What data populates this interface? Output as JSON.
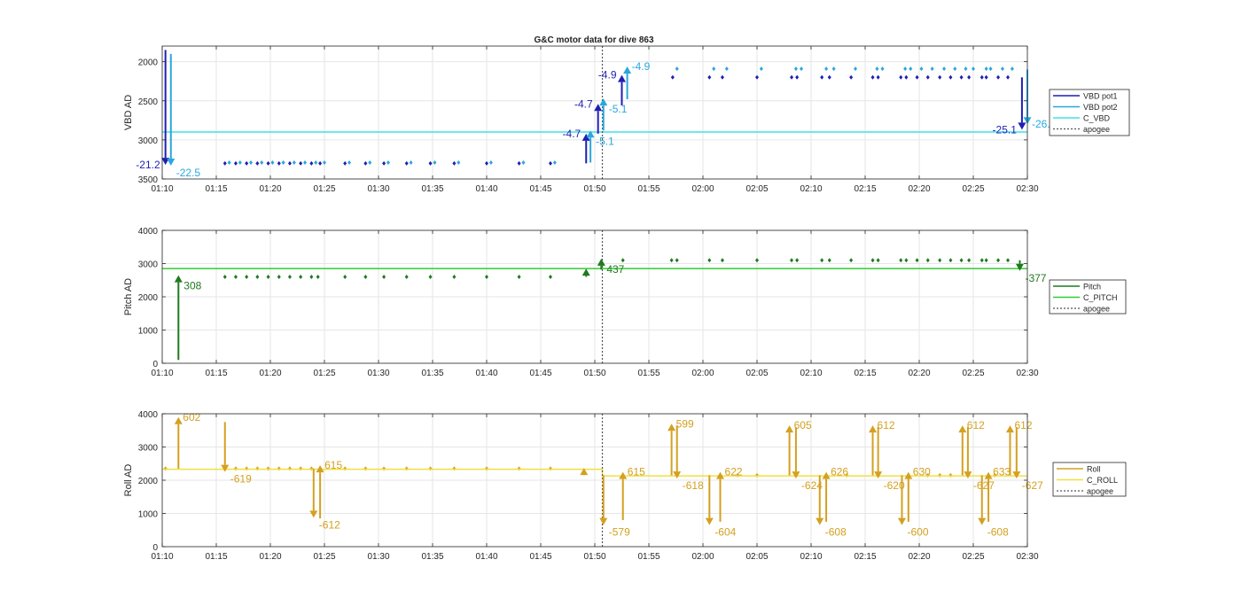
{
  "figure": {
    "title": "G&C motor data for dive 863"
  },
  "chart_data": [
    {
      "type": "scatter",
      "title": "G&C motor data for dive 863",
      "ylabel": "VBD AD",
      "ylim": [
        3500,
        1800
      ],
      "y_reversed": true,
      "yticks": [
        2000,
        2500,
        3000,
        3500
      ],
      "xlim": [
        "01:10",
        "02:30"
      ],
      "xticks": [
        "01:10",
        "01:15",
        "01:20",
        "01:25",
        "01:30",
        "01:35",
        "01:40",
        "01:45",
        "01:50",
        "01:55",
        "02:00",
        "02:05",
        "02:10",
        "02:15",
        "02:20",
        "02:25",
        "02:30"
      ],
      "grid": true,
      "legend_position": "outside-right",
      "apogee": "01:50.7",
      "colors": {
        "VBD pot1": "#1f1fb4",
        "VBD pot2": "#2aa7dd",
        "C_VBD": "#40e0e8",
        "apogee": "#555555"
      },
      "series": [
        {
          "name": "VBD pot1",
          "style": "points",
          "x": [
            "01:15.8",
            "01:16.8",
            "01:17.8",
            "01:18.8",
            "01:19.8",
            "01:20.8",
            "01:21.8",
            "01:22.8",
            "01:23.8",
            "01:24.6",
            "01:26.9",
            "01:28.8",
            "01:30.5",
            "01:32.6",
            "01:34.8",
            "01:37.0",
            "01:40.0",
            "01:43.0",
            "01:45.9",
            "01:57.2",
            "02:00.6",
            "02:01.8",
            "02:05.0",
            "02:08.2",
            "02:08.7",
            "02:11.0",
            "02:11.7",
            "02:13.7",
            "02:15.7",
            "02:16.2",
            "02:18.3",
            "02:18.8",
            "02:19.8",
            "02:20.8",
            "02:21.9",
            "02:22.9",
            "02:23.9",
            "02:24.6",
            "02:25.8",
            "02:26.2",
            "02:27.3",
            "02:28.2"
          ],
          "y": [
            3300,
            3300,
            3300,
            3300,
            3300,
            3300,
            3300,
            3300,
            3300,
            3300,
            3300,
            3300,
            3300,
            3300,
            3300,
            3300,
            3300,
            3300,
            3300,
            2200,
            2200,
            2200,
            2200,
            2200,
            2200,
            2200,
            2200,
            2200,
            2200,
            2200,
            2200,
            2200,
            2200,
            2200,
            2200,
            2200,
            2200,
            2200,
            2200,
            2200,
            2200,
            2200
          ]
        },
        {
          "name": "VBD pot2",
          "style": "points",
          "x": [
            "01:16.2",
            "01:17.2",
            "01:18.2",
            "01:19.2",
            "01:20.2",
            "01:21.2",
            "01:22.2",
            "01:23.2",
            "01:24.2",
            "01:25.0",
            "01:27.3",
            "01:29.2",
            "01:30.9",
            "01:33.0",
            "01:35.2",
            "01:37.4",
            "01:40.4",
            "01:43.4",
            "01:46.3",
            "01:57.6",
            "02:01.0",
            "02:02.2",
            "02:05.4",
            "02:08.6",
            "02:09.1",
            "02:11.4",
            "02:12.1",
            "02:14.1",
            "02:16.1",
            "02:16.6",
            "02:18.7",
            "02:19.2",
            "02:20.2",
            "02:21.2",
            "02:22.3",
            "02:23.3",
            "02:24.3",
            "02:25.0",
            "02:26.2",
            "02:26.6",
            "02:27.7",
            "02:28.6"
          ],
          "y": [
            3290,
            3290,
            3290,
            3290,
            3290,
            3290,
            3290,
            3290,
            3290,
            3290,
            3290,
            3290,
            3290,
            3290,
            3290,
            3290,
            3290,
            3290,
            3290,
            2090,
            2090,
            2090,
            2090,
            2090,
            2090,
            2090,
            2090,
            2090,
            2090,
            2090,
            2090,
            2090,
            2090,
            2090,
            2090,
            2090,
            2090,
            2090,
            2090,
            2090,
            2090,
            2090
          ]
        },
        {
          "name": "C_VBD",
          "style": "line",
          "x": [
            "01:10",
            "02:30"
          ],
          "y": [
            2900,
            2900
          ]
        },
        {
          "name": "apogee",
          "style": "dotted-vline",
          "x": [
            "01:50.7"
          ]
        }
      ],
      "arrows": [
        {
          "series": "VBD pot1",
          "x": "01:10.3",
          "y_start": 1850,
          "y_end": 3320,
          "label": "-21.2",
          "label_side": "left"
        },
        {
          "series": "VBD pot2",
          "x": "01:10.8",
          "y_start": 1900,
          "y_end": 3330,
          "label": "-22.5",
          "label_side": "right-below"
        },
        {
          "series": "VBD pot1",
          "x": "01:49.2",
          "y_start": 3300,
          "y_end": 2920,
          "label": "-4.7",
          "label_side": "left"
        },
        {
          "series": "VBD pot2",
          "x": "01:49.6",
          "y_start": 3290,
          "y_end": 2880,
          "label": "-5.1",
          "label_side": "right-below"
        },
        {
          "series": "VBD pot1",
          "x": "01:50.3",
          "y_start": 2920,
          "y_end": 2540,
          "label": "-4.7",
          "label_side": "left"
        },
        {
          "series": "VBD pot2",
          "x": "01:50.8",
          "y_start": 2880,
          "y_end": 2470,
          "label": "-5.1",
          "label_side": "right-below"
        },
        {
          "series": "VBD pot1",
          "x": "01:52.5",
          "y_start": 2560,
          "y_end": 2170,
          "label": "-4.9",
          "label_side": "left"
        },
        {
          "series": "VBD pot2",
          "x": "01:53.0",
          "y_start": 2480,
          "y_end": 2060,
          "label": "-4.9",
          "label_side": "right"
        },
        {
          "series": "VBD pot1",
          "x": "02:29.5",
          "y_start": 2200,
          "y_end": 2870,
          "label": "-25.1",
          "label_side": "left"
        },
        {
          "series": "VBD pot2",
          "x": "02:30.0",
          "y_start": 2100,
          "y_end": 2800,
          "label": "-26.",
          "label_side": "right"
        }
      ]
    },
    {
      "type": "scatter",
      "ylabel": "Pitch AD",
      "ylim": [
        0,
        4000
      ],
      "yticks": [
        0,
        1000,
        2000,
        3000,
        4000
      ],
      "xlim": [
        "01:10",
        "02:30"
      ],
      "xticks": [
        "01:10",
        "01:15",
        "01:20",
        "01:25",
        "01:30",
        "01:35",
        "01:40",
        "01:45",
        "01:50",
        "01:55",
        "02:00",
        "02:05",
        "02:10",
        "02:15",
        "02:20",
        "02:25",
        "02:30"
      ],
      "grid": true,
      "legend_position": "outside-right",
      "apogee": "01:50.7",
      "colors": {
        "Pitch": "#1f7a1f",
        "C_PITCH": "#33cc33",
        "apogee": "#555555"
      },
      "series": [
        {
          "name": "Pitch",
          "style": "points",
          "x": [
            "01:15.8",
            "01:16.8",
            "01:17.8",
            "01:18.8",
            "01:19.8",
            "01:20.8",
            "01:21.8",
            "01:22.8",
            "01:23.8",
            "01:24.4",
            "01:26.9",
            "01:28.8",
            "01:30.5",
            "01:32.6",
            "01:34.8",
            "01:37.0",
            "01:40.0",
            "01:43.0",
            "01:45.9",
            "01:52.6",
            "01:57.1",
            "01:57.6",
            "02:00.6",
            "02:01.8",
            "02:05.0",
            "02:08.2",
            "02:08.7",
            "02:11.0",
            "02:11.7",
            "02:13.7",
            "02:15.7",
            "02:16.2",
            "02:18.3",
            "02:18.8",
            "02:19.8",
            "02:20.8",
            "02:21.9",
            "02:22.9",
            "02:23.9",
            "02:24.6",
            "02:25.8",
            "02:26.2",
            "02:27.3",
            "02:28.2"
          ],
          "y": [
            2600,
            2600,
            2600,
            2600,
            2600,
            2600,
            2600,
            2600,
            2600,
            2600,
            2600,
            2600,
            2600,
            2600,
            2600,
            2600,
            2600,
            2600,
            2600,
            3100,
            3100,
            3100,
            3100,
            3100,
            3100,
            3100,
            3100,
            3100,
            3100,
            3100,
            3100,
            3100,
            3100,
            3100,
            3100,
            3100,
            3100,
            3100,
            3100,
            3100,
            3100,
            3100,
            3100,
            3100
          ]
        },
        {
          "name": "C_PITCH",
          "style": "line",
          "x": [
            "01:10",
            "02:30"
          ],
          "y": [
            2850,
            2850
          ]
        },
        {
          "name": "apogee",
          "style": "dotted-vline",
          "x": [
            "01:50.7"
          ]
        }
      ],
      "arrows": [
        {
          "series": "Pitch",
          "x": "01:11.5",
          "y_start": 100,
          "y_end": 2650,
          "label": "308",
          "label_side": "right-below"
        },
        {
          "series": "Pitch",
          "x": "01:49.2",
          "y_start": 2600,
          "y_end": 2850,
          "label": "",
          "label_side": "none"
        },
        {
          "series": "Pitch",
          "x": "01:50.6",
          "y_start": 2820,
          "y_end": 3150,
          "label": "437",
          "label_side": "right-below"
        },
        {
          "series": "Pitch",
          "x": "02:29.3",
          "y_start": 3100,
          "y_end": 2780,
          "label": "-377",
          "label_side": "right-below"
        }
      ]
    },
    {
      "type": "scatter",
      "ylabel": "Roll AD",
      "ylim": [
        0,
        4000
      ],
      "yticks": [
        0,
        1000,
        2000,
        3000,
        4000
      ],
      "xlim": [
        "01:10",
        "02:30"
      ],
      "xticks": [
        "01:10",
        "01:15",
        "01:20",
        "01:25",
        "01:30",
        "01:35",
        "01:40",
        "01:45",
        "01:50",
        "01:55",
        "02:00",
        "02:05",
        "02:10",
        "02:15",
        "02:20",
        "02:25",
        "02:30"
      ],
      "grid": true,
      "legend_position": "outside-right",
      "apogee": "01:50.7",
      "colors": {
        "Roll": "#d4a020",
        "C_ROLL": "#f0e040",
        "apogee": "#555555"
      },
      "series": [
        {
          "name": "Roll",
          "style": "points",
          "x": [
            "01:10.3",
            "01:16.8",
            "01:17.8",
            "01:18.8",
            "01:19.8",
            "01:20.8",
            "01:21.8",
            "01:22.8",
            "01:23.8",
            "01:26.9",
            "01:28.8",
            "01:30.5",
            "01:32.6",
            "01:34.8",
            "01:37.0",
            "01:40.0",
            "01:43.0",
            "01:45.9",
            "02:03.2",
            "02:05.0",
            "02:13.3",
            "02:20.8",
            "02:21.9",
            "02:22.9",
            "02:27.0"
          ],
          "y": [
            2350,
            2350,
            2350,
            2350,
            2350,
            2350,
            2350,
            2350,
            2350,
            2350,
            2350,
            2350,
            2350,
            2350,
            2350,
            2350,
            2350,
            2350,
            2150,
            2150,
            2150,
            2150,
            2150,
            2150,
            2150
          ]
        },
        {
          "name": "C_ROLL",
          "style": "line",
          "x": [
            "01:10",
            "01:50.7",
            "01:50.7",
            "02:30"
          ],
          "y": [
            2330,
            2330,
            2130,
            2130
          ]
        },
        {
          "name": "apogee",
          "style": "dotted-vline",
          "x": [
            "01:50.7"
          ]
        }
      ],
      "arrows": [
        {
          "series": "Roll",
          "x": "01:11.5",
          "y_start": 2350,
          "y_end": 3900,
          "label": "602",
          "label_side": "right"
        },
        {
          "series": "Roll",
          "x": "01:15.8",
          "y_start": 3750,
          "y_end": 2250,
          "label": "-619",
          "label_side": "right-below"
        },
        {
          "series": "Roll",
          "x": "01:24.0",
          "y_start": 2350,
          "y_end": 870,
          "label": "-612",
          "label_side": "right-below"
        },
        {
          "series": "Roll",
          "x": "01:24.6",
          "y_start": 850,
          "y_end": 2450,
          "label": "615",
          "label_side": "right"
        },
        {
          "series": "Roll",
          "x": "01:49.0",
          "y_start": 2150,
          "y_end": 2370,
          "label": "",
          "label_side": "none"
        },
        {
          "series": "Roll",
          "x": "01:50.8",
          "y_start": 2150,
          "y_end": 650,
          "label": "-579",
          "label_side": "right-below"
        },
        {
          "series": "Roll",
          "x": "01:52.6",
          "y_start": 800,
          "y_end": 2250,
          "label": "615",
          "label_side": "right"
        },
        {
          "series": "Roll",
          "x": "01:57.1",
          "y_start": 2150,
          "y_end": 3700,
          "label": "599",
          "label_side": "right"
        },
        {
          "series": "Roll",
          "x": "01:57.6",
          "y_start": 3650,
          "y_end": 2050,
          "label": "-618",
          "label_side": "right-below"
        },
        {
          "series": "Roll",
          "x": "02:00.6",
          "y_start": 2150,
          "y_end": 650,
          "label": "-604",
          "label_side": "right-below"
        },
        {
          "series": "Roll",
          "x": "02:01.6",
          "y_start": 750,
          "y_end": 2250,
          "label": "622",
          "label_side": "right"
        },
        {
          "series": "Roll",
          "x": "02:08.0",
          "y_start": 2150,
          "y_end": 3650,
          "label": "605",
          "label_side": "right"
        },
        {
          "series": "Roll",
          "x": "02:08.6",
          "y_start": 3600,
          "y_end": 2050,
          "label": "-624",
          "label_side": "right-below"
        },
        {
          "series": "Roll",
          "x": "02:10.8",
          "y_start": 2150,
          "y_end": 650,
          "label": "-608",
          "label_side": "right-below"
        },
        {
          "series": "Roll",
          "x": "02:11.4",
          "y_start": 750,
          "y_end": 2250,
          "label": "626",
          "label_side": "right"
        },
        {
          "series": "Roll",
          "x": "02:15.7",
          "y_start": 2150,
          "y_end": 3650,
          "label": "612",
          "label_side": "right"
        },
        {
          "series": "Roll",
          "x": "02:16.2",
          "y_start": 3600,
          "y_end": 2050,
          "label": "-620",
          "label_side": "right-below"
        },
        {
          "series": "Roll",
          "x": "02:18.4",
          "y_start": 2150,
          "y_end": 650,
          "label": "-600",
          "label_side": "right-below"
        },
        {
          "series": "Roll",
          "x": "02:19.0",
          "y_start": 750,
          "y_end": 2250,
          "label": "630",
          "label_side": "right"
        },
        {
          "series": "Roll",
          "x": "02:24.0",
          "y_start": 2150,
          "y_end": 3650,
          "label": "612",
          "label_side": "right"
        },
        {
          "series": "Roll",
          "x": "02:24.5",
          "y_start": 3600,
          "y_end": 2050,
          "label": "-627",
          "label_side": "right-below"
        },
        {
          "series": "Roll",
          "x": "02:25.8",
          "y_start": 2150,
          "y_end": 650,
          "label": "-608",
          "label_side": "right-below"
        },
        {
          "series": "Roll",
          "x": "02:26.4",
          "y_start": 750,
          "y_end": 2250,
          "label": "633",
          "label_side": "right"
        },
        {
          "series": "Roll",
          "x": "02:28.4",
          "y_start": 2150,
          "y_end": 3650,
          "label": "612",
          "label_side": "right"
        },
        {
          "series": "Roll",
          "x": "02:29.0",
          "y_start": 3600,
          "y_end": 2050,
          "label": "-627",
          "label_side": "right-below"
        }
      ]
    }
  ]
}
